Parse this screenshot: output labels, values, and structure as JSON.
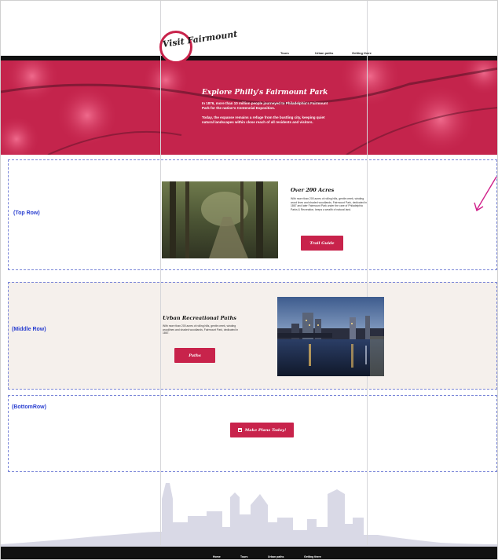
{
  "header": {
    "logo_text": "Visit Fairmount",
    "nav": [
      "Tours",
      "Urban paths",
      "Getting there"
    ]
  },
  "hero": {
    "title": "Explore Philly's Fairmount Park",
    "paragraph_1": "In 1876, more than 10 million people journeyed to Philadelphia's Fairmount Park for the nation's Centennial Exposition.",
    "paragraph_2": "Today, the expanse remains a refuge from the bustling city, keeping quiet natural landscapes within close reach of all residents and visitors."
  },
  "rows": {
    "top": {
      "label": "(Top Row)",
      "card_title": "Over 200 Acres",
      "card_text": "With more than 200 acres of rolling hills, gentle creek, winding wood lines and shaded woodlands, Fairmount Park, dedicated in 1867 and later Fairmount Park under the care of Philadelphia Parks & Recreation, keeps a wealth of natural land.",
      "button_label": "Trail Guide"
    },
    "middle": {
      "label": "(Middle Row)",
      "card_title": "Urban Recreational Paths",
      "card_text": "With more than 200 acres of rolling hills, gentle creek, winding woodlines and shaded woodlands, Fairmount Park, dedicated in 1867.",
      "button_label": "Paths"
    },
    "bottom": {
      "label": "(BottomRow)",
      "button_label": "Make Plans Today!",
      "button_icon": "calendar-icon"
    }
  },
  "footer": {
    "nav": [
      "Home",
      "Tours",
      "Urban paths",
      "Getting there"
    ]
  },
  "colors": {
    "accent": "#c8234b",
    "hero": "#c4244c",
    "row_outline": "#7a86d8",
    "row_label": "#2a3fd0",
    "middle_bg": "#f5f0ec",
    "skyline": "#d9d9e6",
    "arrow": "#d0208a"
  }
}
